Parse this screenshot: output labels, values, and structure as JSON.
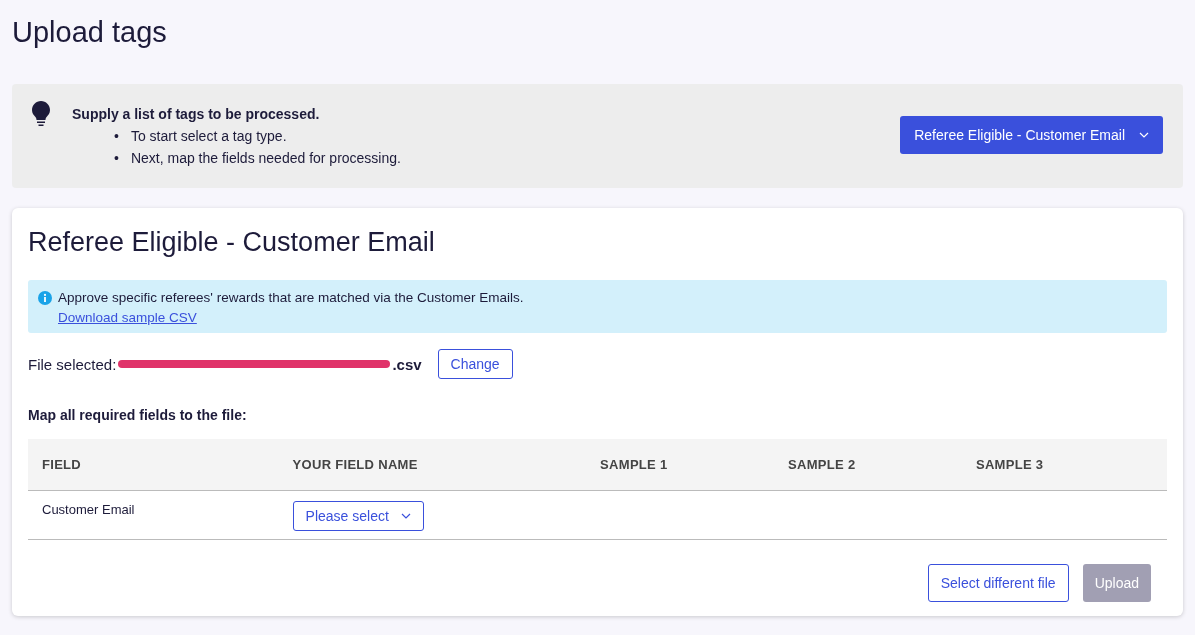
{
  "page_title": "Upload tags",
  "instructions": {
    "heading": "Supply a list of tags to be processed.",
    "bullet": "•",
    "steps": [
      "To start select a tag type.",
      "Next, map the fields needed for processing."
    ],
    "tag_type_dropdown": "Referee Eligible - Customer Email"
  },
  "card": {
    "title": "Referee Eligible - Customer Email",
    "notice": {
      "text": "Approve specific referees' rewards that are matched via the Customer Emails.",
      "link": "Download sample CSV"
    },
    "file": {
      "label": "File selected:",
      "name_visible": ".csv",
      "redacted": true,
      "change_button": "Change"
    },
    "map_heading": "Map all required fields to the file:",
    "table": {
      "columns": [
        "FIELD",
        "YOUR FIELD NAME",
        "SAMPLE 1",
        "SAMPLE 2",
        "SAMPLE 3"
      ],
      "rows": [
        {
          "field": "Customer Email",
          "select": "Please select"
        }
      ]
    },
    "buttons": [
      {
        "label": "Select different file",
        "kind": "outline",
        "disabled": false
      },
      {
        "label": "Upload",
        "kind": "primary",
        "disabled": true
      }
    ]
  }
}
